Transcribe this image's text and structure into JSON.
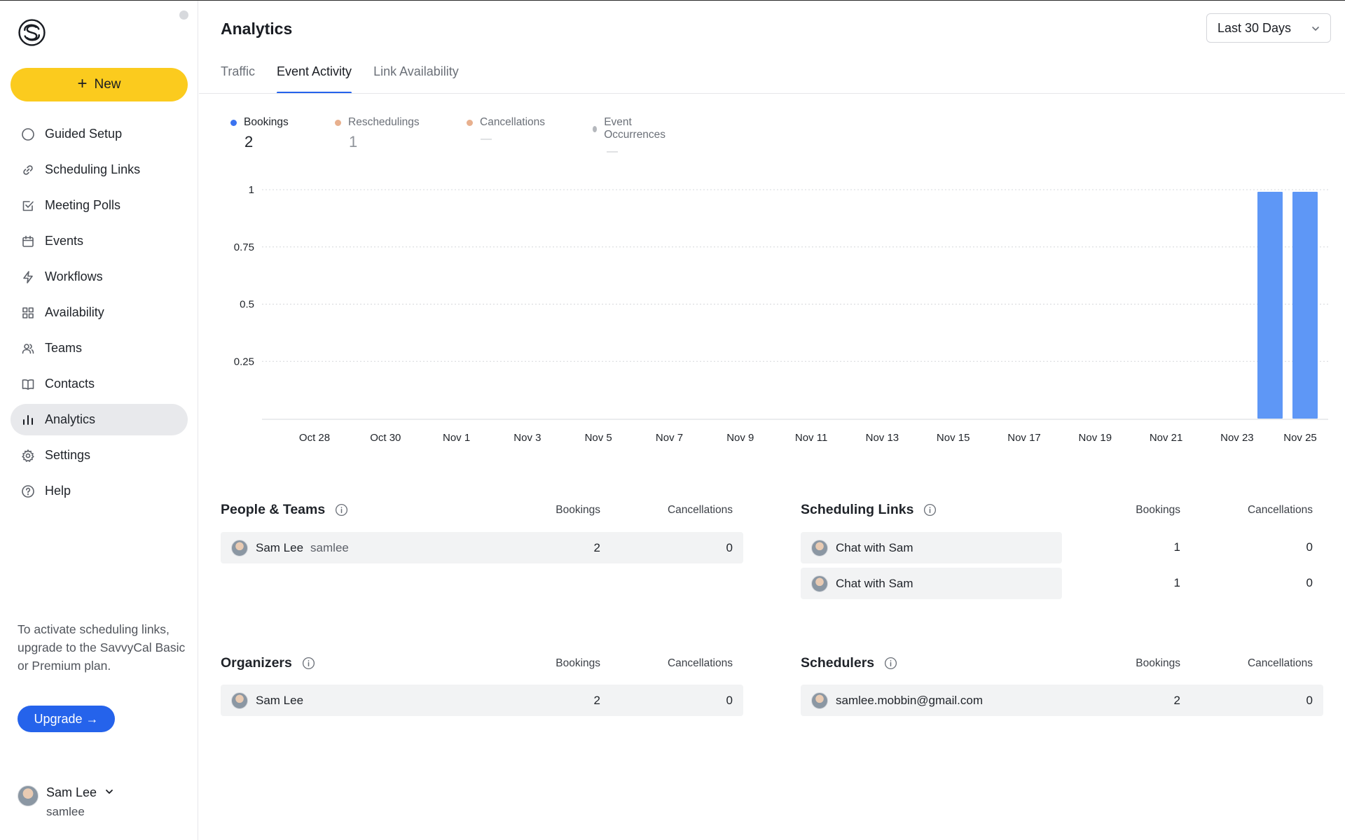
{
  "sidebar": {
    "new_label": "New",
    "items": [
      {
        "label": "Guided Setup",
        "icon": "circle-icon"
      },
      {
        "label": "Scheduling Links",
        "icon": "link-icon"
      },
      {
        "label": "Meeting Polls",
        "icon": "checkbox-icon"
      },
      {
        "label": "Events",
        "icon": "calendar-icon"
      },
      {
        "label": "Workflows",
        "icon": "bolt-icon"
      },
      {
        "label": "Availability",
        "icon": "grid-icon"
      },
      {
        "label": "Teams",
        "icon": "users-icon"
      },
      {
        "label": "Contacts",
        "icon": "book-icon"
      },
      {
        "label": "Analytics",
        "icon": "bar-chart-icon",
        "active": true
      },
      {
        "label": "Settings",
        "icon": "gear-icon"
      },
      {
        "label": "Help",
        "icon": "help-circle-icon"
      }
    ],
    "upgrade_text": "To activate scheduling links, upgrade to the SavvyCal Basic or Premium plan.",
    "upgrade_label": "Upgrade →",
    "user": {
      "name": "Sam Lee",
      "handle": "samlee"
    }
  },
  "header": {
    "title": "Analytics",
    "range": "Last 30 Days"
  },
  "tabs": [
    {
      "label": "Traffic"
    },
    {
      "label": "Event Activity",
      "active": true
    },
    {
      "label": "Link Availability"
    }
  ],
  "legend": [
    {
      "label": "Bookings",
      "value": "2",
      "color": "#3b73f0",
      "active": true
    },
    {
      "label": "Reschedulings",
      "value": "1",
      "color": "#e8b08e",
      "active": false
    },
    {
      "label": "Cancellations",
      "value": "—",
      "color": "#e8b08e",
      "active": false
    },
    {
      "label": "Event Occurrences",
      "value": "—",
      "color": "#b5b8bd",
      "active": false
    }
  ],
  "chart_data": {
    "type": "bar",
    "x_labels": [
      "Oct 28",
      "Oct 30",
      "Nov 1",
      "Nov 3",
      "Nov 5",
      "Nov 7",
      "Nov 9",
      "Nov 11",
      "Nov 13",
      "Nov 15",
      "Nov 17",
      "Nov 19",
      "Nov 21",
      "Nov 23",
      "Nov 25"
    ],
    "y_ticks": [
      "1",
      "0.75",
      "0.5",
      "0.25"
    ],
    "ylim": [
      0,
      1
    ],
    "series": [
      {
        "name": "Bookings",
        "color": "#5e97f6",
        "points": [
          {
            "x": "Nov 24",
            "y": 1
          },
          {
            "x": "Nov 25",
            "y": 1
          }
        ]
      }
    ],
    "grid": true
  },
  "people_teams": {
    "title": "People & Teams",
    "col_bookings": "Bookings",
    "col_cancellations": "Cancellations",
    "rows": [
      {
        "name": "Sam Lee",
        "handle": "samlee",
        "bookings": "2",
        "cancellations": "0"
      }
    ]
  },
  "scheduling_links": {
    "title": "Scheduling Links",
    "col_bookings": "Bookings",
    "col_cancellations": "Cancellations",
    "rows": [
      {
        "name": "Chat with Sam",
        "bookings": "1",
        "cancellations": "0"
      },
      {
        "name": "Chat with Sam",
        "bookings": "1",
        "cancellations": "0"
      }
    ]
  },
  "organizers": {
    "title": "Organizers",
    "col_bookings": "Bookings",
    "col_cancellations": "Cancellations",
    "rows": [
      {
        "name": "Sam Lee",
        "bookings": "2",
        "cancellations": "0"
      }
    ]
  },
  "schedulers": {
    "title": "Schedulers",
    "col_bookings": "Bookings",
    "col_cancellations": "Cancellations",
    "rows": [
      {
        "name": "samlee.mobbin@gmail.com",
        "bookings": "2",
        "cancellations": "0"
      }
    ]
  }
}
